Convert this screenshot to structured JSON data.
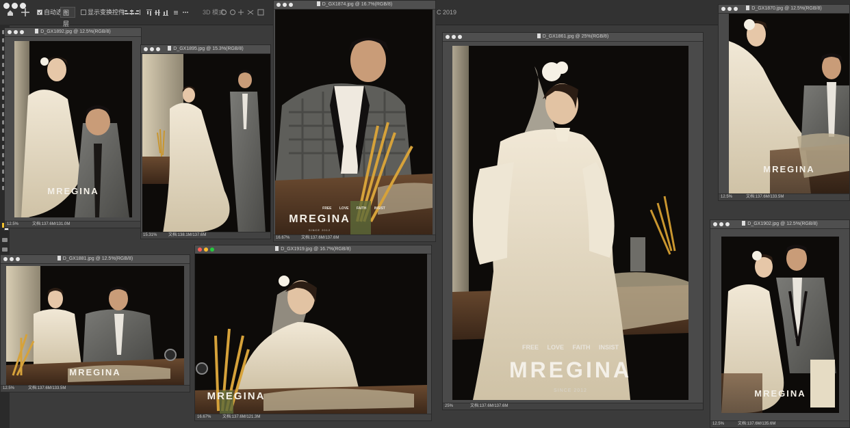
{
  "options_bar": {
    "auto_select_label": "自动选择:",
    "layer_select": "图层",
    "show_transform_label": "显示变换控件",
    "mode_3d": "3D 模式:",
    "app_title_fragment": "C 2019"
  },
  "windows": [
    {
      "name": "D_GX1892.jpg @ 12.5%(RGB/8)",
      "zoom": "12.5%",
      "doc": "文档:137.6M/131.0M"
    },
    {
      "name": "D_GX1895.jpg @ 15.3%(RGB/8)",
      "zoom": "15.31%",
      "doc": "文档:138.1M/137.6M"
    },
    {
      "name": "D_GX1874.jpg @ 16.7%(RGB/8)",
      "zoom": "16.67%",
      "doc": "文档:137.6M/137.6M"
    },
    {
      "name": "D_GX1861.jpg @ 25%(RGB/8)",
      "zoom": "25%",
      "doc": "文档:137.6M/137.6M"
    },
    {
      "name": "D_GX1870.jpg @ 12.5%(RGB/8)",
      "zoom": "12.5%",
      "doc": "文档:137.6M/133.5M"
    },
    {
      "name": "D_GX1881.jpg @ 12.5%(RGB/8)",
      "zoom": "12.5%",
      "doc": "文档:137.6M/133.5M"
    },
    {
      "name": "D_GX1919.jpg @ 16.7%(RGB/8)",
      "zoom": "16.67%",
      "doc": "文档:137.6M/121.3M"
    },
    {
      "name": "D_GX1902.jpg @ 12.5%(RGB/8)",
      "zoom": "12.5%",
      "doc": "文档:137.6M/135.6M"
    }
  ],
  "watermark": {
    "brand": "MREGINA",
    "tags": [
      "FREE",
      "LOVE",
      "FAITH",
      "INSIST"
    ],
    "since": "SINCE 2012",
    "tag_icons": [
      "sun-icon",
      "heart-icon",
      "crown-icon",
      "star-icon"
    ]
  },
  "colors": {
    "workspace": "#3b3b3b",
    "window_frame": "#4a4a4a",
    "photo_bg": "#0d0b09",
    "gown": "#e9dfcc",
    "suit_gray": "#6b6b68",
    "wheat": "#c9962f",
    "table_wood": "#5a3d28"
  }
}
